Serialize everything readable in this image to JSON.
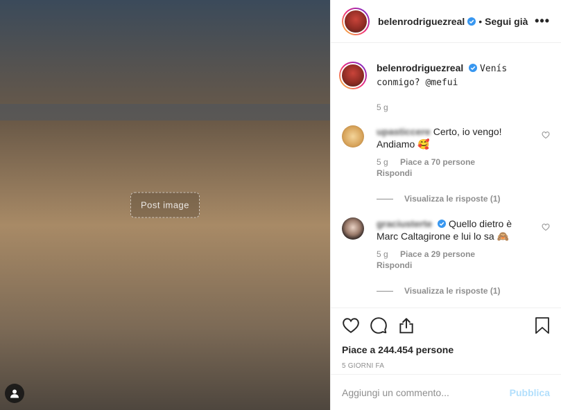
{
  "photo": {
    "placeholder": "Post image"
  },
  "header": {
    "username": "belenrodriguezreal",
    "separator": "•",
    "follow_label": "Segui già",
    "more_label": "•••"
  },
  "caption": {
    "username": "belenrodriguezreal",
    "text": "Venís conmigo? @mefui",
    "time": "5 g"
  },
  "comments": [
    {
      "username": "upasticcere",
      "text": "Certo, io vengo! Andiamo 🥰",
      "time": "5 g",
      "likes": "Piace a 70 persone",
      "reply": "Rispondi",
      "view_replies": "Visualizza le risposte (1)"
    },
    {
      "username": "graciusterte",
      "text": "Quello dietro è Marc Caltagirone e lui lo sa 🙈",
      "time": "5 g",
      "likes": "Piace a 29 persone",
      "reply": "Rispondi",
      "view_replies": "Visualizza le risposte (1)"
    }
  ],
  "post": {
    "likes": "Piace a 244.454 persone",
    "date": "5 GIORNI FA"
  },
  "composer": {
    "placeholder": "Aggiungi un commento...",
    "publish": "Pubblica"
  },
  "colors": {
    "verified": "#3897f0",
    "publish_disabled": "#b2dffc",
    "muted": "#8e8e8e"
  }
}
